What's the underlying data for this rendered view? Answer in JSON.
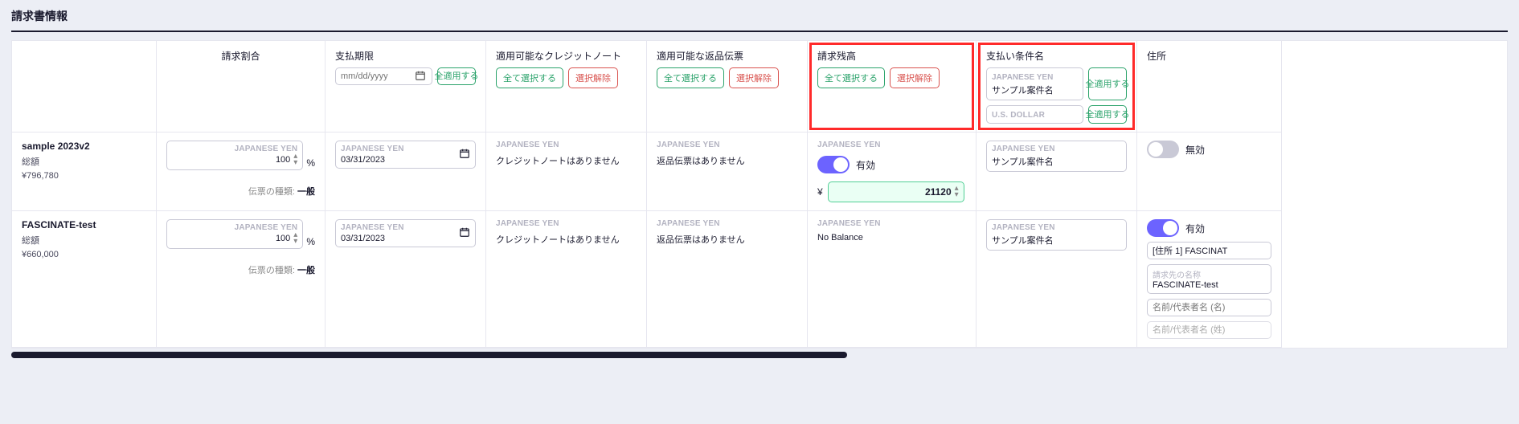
{
  "title": "請求書情報",
  "columns": {
    "ratio": "請求割合",
    "deadline": "支払期限",
    "credit": "適用可能なクレジットノート",
    "return": "適用可能な返品伝票",
    "balance": "請求残高",
    "cond": "支払い条件名",
    "addr": "住所"
  },
  "hdr": {
    "deadline_placeholder": "mm/dd/yyyy",
    "apply_all": "全適用する",
    "select_all": "全て選択する",
    "deselect": "選択解除",
    "cond_jpy_placeholder": "JAPANESE YEN",
    "cond_jpy_sample": "サンプル案件名",
    "cond_usd_placeholder": "U.S. DOLLAR"
  },
  "rows": [
    {
      "id": "r1",
      "name": "sample 2023v2",
      "total_label": "総額",
      "total": "¥796,780",
      "currency": "JAPANESE YEN",
      "ratio_value": "100",
      "voucher_type_label": "伝票の種類:",
      "voucher_type": "一般",
      "deadline": "03/31/2023",
      "credit_note": "クレジットノートはありません",
      "return_slip": "返品伝票はありません",
      "balance_toggle_on": true,
      "balance_toggle_label": "有効",
      "balance_currency_symbol": "¥",
      "balance_amount": "21120",
      "cond_sample": "サンプル案件名",
      "addr_toggle_on": false,
      "addr_toggle_label": "無効"
    },
    {
      "id": "r2",
      "name": "FASCINATE-test",
      "total_label": "総額",
      "total": "¥660,000",
      "currency": "JAPANESE YEN",
      "ratio_value": "100",
      "voucher_type_label": "伝票の種類:",
      "voucher_type": "一般",
      "deadline": "03/31/2023",
      "credit_note": "クレジットノートはありません",
      "return_slip": "返品伝票はありません",
      "balance_text": "No Balance",
      "cond_sample": "サンプル案件名",
      "addr_toggle_on": true,
      "addr_toggle_label": "有効",
      "addr_value": "[住所 1] FASCINAT",
      "billto_label": "請求先の名称",
      "billto_value": "FASCINATE-test",
      "rep_name_label": "名前/代表者名 (名)",
      "rep_surname_label": "名前/代表者名 (姓)"
    }
  ]
}
